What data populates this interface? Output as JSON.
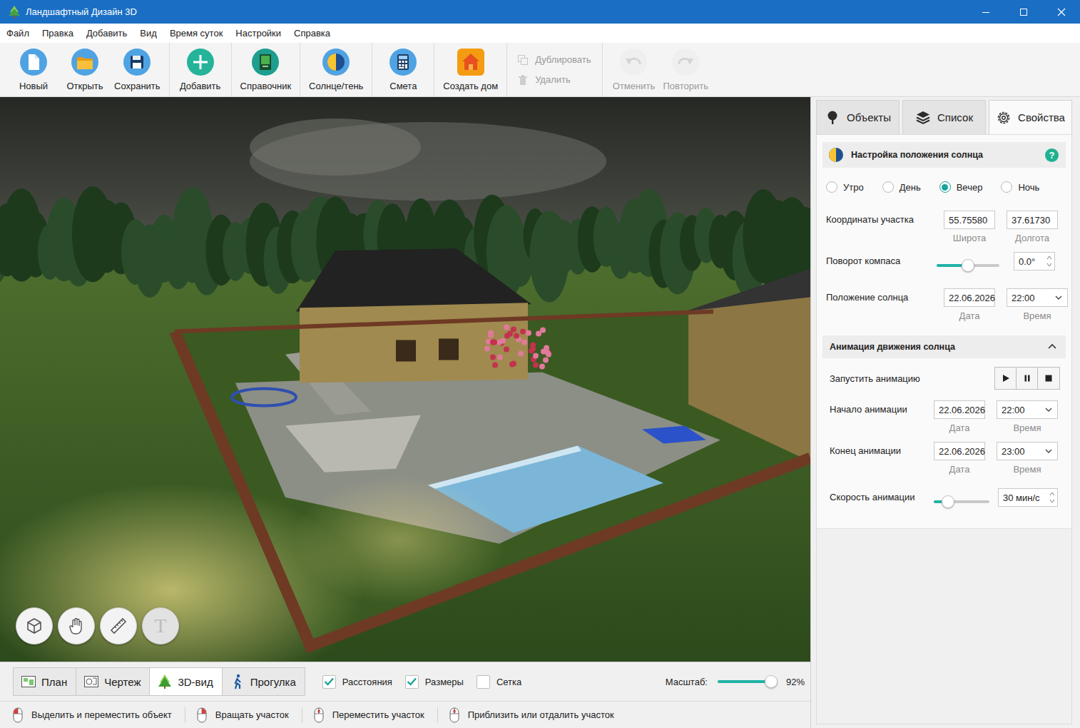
{
  "window": {
    "title": "Ландшафтный Дизайн 3D"
  },
  "menu": [
    "Файл",
    "Правка",
    "Добавить",
    "Вид",
    "Время суток",
    "Настройки",
    "Справка"
  ],
  "toolbar": [
    {
      "kind": "large",
      "buttons": [
        {
          "label": "Новый",
          "disabled": false
        },
        {
          "label": "Открыть",
          "disabled": false
        },
        {
          "label": "Сохранить",
          "disabled": false
        }
      ]
    },
    {
      "kind": "large",
      "buttons": [
        {
          "label": "Добавить",
          "disabled": false
        }
      ]
    },
    {
      "kind": "large",
      "buttons": [
        {
          "label": "Справочник",
          "disabled": false
        }
      ]
    },
    {
      "kind": "large",
      "buttons": [
        {
          "label": "Солнце/тень",
          "disabled": false
        }
      ]
    },
    {
      "kind": "large",
      "buttons": [
        {
          "label": "Смета",
          "disabled": false
        }
      ]
    },
    {
      "kind": "large",
      "buttons": [
        {
          "label": "Создать дом",
          "disabled": false
        }
      ]
    },
    {
      "kind": "small",
      "buttons": [
        {
          "label": "Дублировать",
          "disabled": true
        },
        {
          "label": "Удалить",
          "disabled": true
        }
      ]
    },
    {
      "kind": "large",
      "buttons": [
        {
          "label": "Отменить",
          "disabled": true
        },
        {
          "label": "Повторить",
          "disabled": true
        }
      ]
    }
  ],
  "view_tools": [
    {
      "disabled": false
    },
    {
      "disabled": false
    },
    {
      "disabled": false
    },
    {
      "label": "T",
      "disabled": true
    }
  ],
  "view_tabs": [
    {
      "label": "План",
      "selected": false
    },
    {
      "label": "Чертеж",
      "selected": false
    },
    {
      "label": "3D-вид",
      "selected": true
    },
    {
      "label": "Прогулка",
      "selected": false
    }
  ],
  "view_options": [
    {
      "label": "Расстояния",
      "checked": true
    },
    {
      "label": "Размеры",
      "checked": true
    },
    {
      "label": "Сетка",
      "checked": false
    }
  ],
  "scale": {
    "label": "Масштаб:",
    "level": 0.92,
    "reading": "92%"
  },
  "status_bar": [
    "Выделить и переместить объект",
    "Вращать участок",
    "Переместить участок",
    "Приблизить или отдалить участок"
  ],
  "panel": {
    "tabs": [
      {
        "label": "Объекты",
        "selected": false
      },
      {
        "label": "Список",
        "selected": false
      },
      {
        "label": "Свойства",
        "selected": true
      }
    ],
    "sun": {
      "title": "Настройка положения солнца",
      "help": "?",
      "time_of_day": [
        {
          "label": "Утро",
          "selected": false
        },
        {
          "label": "День",
          "selected": false
        },
        {
          "label": "Вечер",
          "selected": true
        },
        {
          "label": "Ночь",
          "selected": false
        }
      ],
      "coordinates": {
        "label": "Координаты участка",
        "fields": [
          {
            "value": "55.75580",
            "caption": "Широта",
            "kind": "input"
          },
          {
            "value": "37.61730",
            "caption": "Долгота",
            "kind": "input"
          }
        ]
      },
      "compass": {
        "label": "Поворот компаса",
        "level": 0.5,
        "value": "0.0°"
      },
      "position": {
        "label": "Положение солнца",
        "fields": [
          {
            "value": "22.06.2026",
            "caption": "Дата",
            "kind": "input"
          },
          {
            "value": "22:00",
            "caption": "Время",
            "kind": "select"
          }
        ]
      }
    },
    "animation": {
      "title": "Анимация движения солнца",
      "expanded": true,
      "run": {
        "label": "Запустить анимацию"
      },
      "start": {
        "label": "Начало анимации",
        "fields": [
          {
            "value": "22.06.2026",
            "caption": "Дата",
            "kind": "input"
          },
          {
            "value": "22:00",
            "caption": "Время",
            "kind": "select"
          }
        ]
      },
      "end": {
        "label": "Конец анимации",
        "fields": [
          {
            "value": "22.06.2026",
            "caption": "Дата",
            "kind": "input"
          },
          {
            "value": "23:00",
            "caption": "Время",
            "kind": "select"
          }
        ]
      },
      "speed": {
        "label": "Скорость анимации",
        "level": 0.25,
        "value": "30 мин/с"
      }
    }
  }
}
